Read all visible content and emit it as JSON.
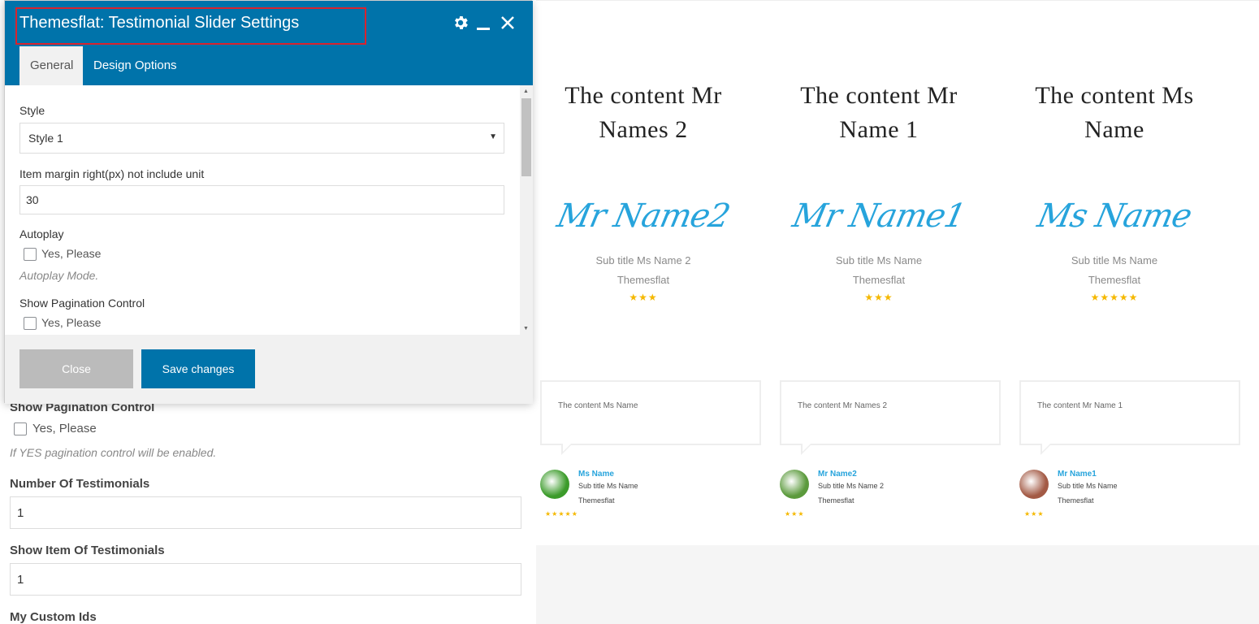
{
  "background_form": {
    "partial_label": "Show Pagination Control",
    "checkbox_text": "Yes, Please",
    "hint": "If YES pagination control will be enabled.",
    "number_label": "Number Of Testimonials",
    "number_value": "1",
    "show_item_label": "Show Item Of Testimonials",
    "show_item_value": "1",
    "custom_ids_label": "My Custom Ids"
  },
  "modal": {
    "title": "Themesflat: Testimonial Slider Settings",
    "tabs": [
      {
        "label": "General"
      },
      {
        "label": "Design Options"
      }
    ],
    "fields": {
      "style_label": "Style",
      "style_value": "Style 1",
      "margin_label": "Item margin right(px) not include unit",
      "margin_value": "30",
      "autoplay_label": "Autoplay",
      "autoplay_checkbox": "Yes, Please",
      "autoplay_hint": "Autoplay Mode.",
      "pagination_label": "Show Pagination Control",
      "pagination_checkbox": "Yes, Please"
    },
    "buttons": {
      "close": "Close",
      "save": "Save changes"
    }
  },
  "preview": {
    "top_cards": [
      {
        "content": "The content Mr Names 2",
        "signature": "Mr Name2",
        "subtitle": "Sub title Ms Name 2",
        "company": "Themesflat",
        "stars": "★★★"
      },
      {
        "content": "The content Mr Name 1",
        "signature": "Mr Name1",
        "subtitle": "Sub title Ms Name",
        "company": "Themesflat",
        "stars": "★★★"
      },
      {
        "content": "The content Ms Name",
        "signature": "Ms Name",
        "subtitle": "Sub title Ms Name",
        "company": "Themesflat",
        "stars": "★★★★★"
      }
    ],
    "bottom_cards": [
      {
        "content": "The content Ms Name",
        "name": "Ms Name",
        "subtitle": "Sub title Ms Name",
        "company": "Themesflat",
        "stars": "★★★★★",
        "avatar_color": "#3b9b2a"
      },
      {
        "content": "The content Mr Names 2",
        "name": "Mr Name2",
        "subtitle": "Sub title Ms Name 2",
        "company": "Themesflat",
        "stars": "★★★",
        "avatar_color": "#5b9a3c"
      },
      {
        "content": "The content Mr Name 1",
        "name": "Mr Name1",
        "subtitle": "Sub title Ms Name",
        "company": "Themesflat",
        "stars": "★★★",
        "avatar_color": "#a35a45"
      }
    ]
  },
  "colors": {
    "brand": "#0073aa",
    "accent_blue": "#27a4dc",
    "star": "#f5b800",
    "highlight": "#d9232e"
  }
}
